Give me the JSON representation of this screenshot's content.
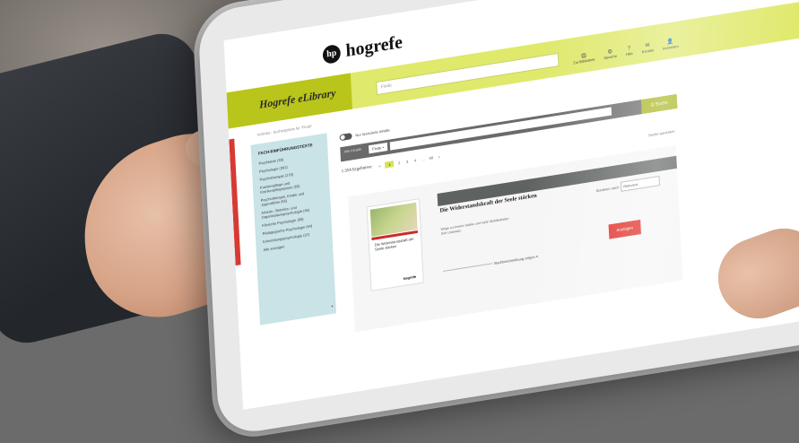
{
  "brand": {
    "name": "hogrefe",
    "logo_letters": "hp"
  },
  "library": {
    "title": "Hogrefe eLibrary"
  },
  "top_search": {
    "placeholder": "Finde"
  },
  "top_actions": [
    {
      "label": "Zur Bibliothek",
      "icon": "library-icon"
    },
    {
      "label": "Sprache",
      "icon": "globe-icon"
    },
    {
      "label": "Hilfe",
      "icon": "help-icon"
    },
    {
      "label": "Kontakt",
      "icon": "contact-icon"
    },
    {
      "label": "Anmelden",
      "icon": "user-icon"
    }
  ],
  "breadcrumb": "eLibrary › Suchergebnis für \"Finde\"",
  "sidebar": {
    "heading": "FACH-EINFÜHRUNGSTEXTE",
    "items": [
      "Psychiatrie (39)",
      "Psychologie (261)",
      "Psychotherapie (278)",
      "Krankenpflege und Krankenpflegepraxis (55)",
      "Psychotherapie, Kinder und Jugendliche (55)",
      "Arbeits-, Betriebs- und Organisationspsychologie (45)",
      "Klinische Psychologie (89)",
      "Pädagogische Psychologie (64)",
      "Entwicklungspsychologie (37)",
      "Alle anzeigen"
    ]
  },
  "toggle": {
    "label": "Nur lizenzierte Inhalte"
  },
  "search": {
    "tab": "Alle Inhalte",
    "chip": "Finde ×",
    "button": "Q Suche"
  },
  "results": {
    "count": "1.354 Ergebnisse",
    "pages": [
      "«",
      "1",
      "2",
      "3",
      "4",
      "…",
      "68",
      "»"
    ],
    "save_search": "Suche speichern"
  },
  "book": {
    "title": "Die Widerstandskraft der Seele stärken",
    "meta_line1": "Wege zu innerer Stärke und mehr Wohlbefinden",
    "meta_line2": "Dirk Unterwitz",
    "cover_text": "Die Widerstandskraft der Seele stärken",
    "cover_logo": "hogrefe"
  },
  "sort": {
    "label": "Sortieren nach",
    "value": "Relevanz"
  },
  "show_button": "Anzeigen",
  "desc_link": "Buchbeschreibung zeigen ▾"
}
